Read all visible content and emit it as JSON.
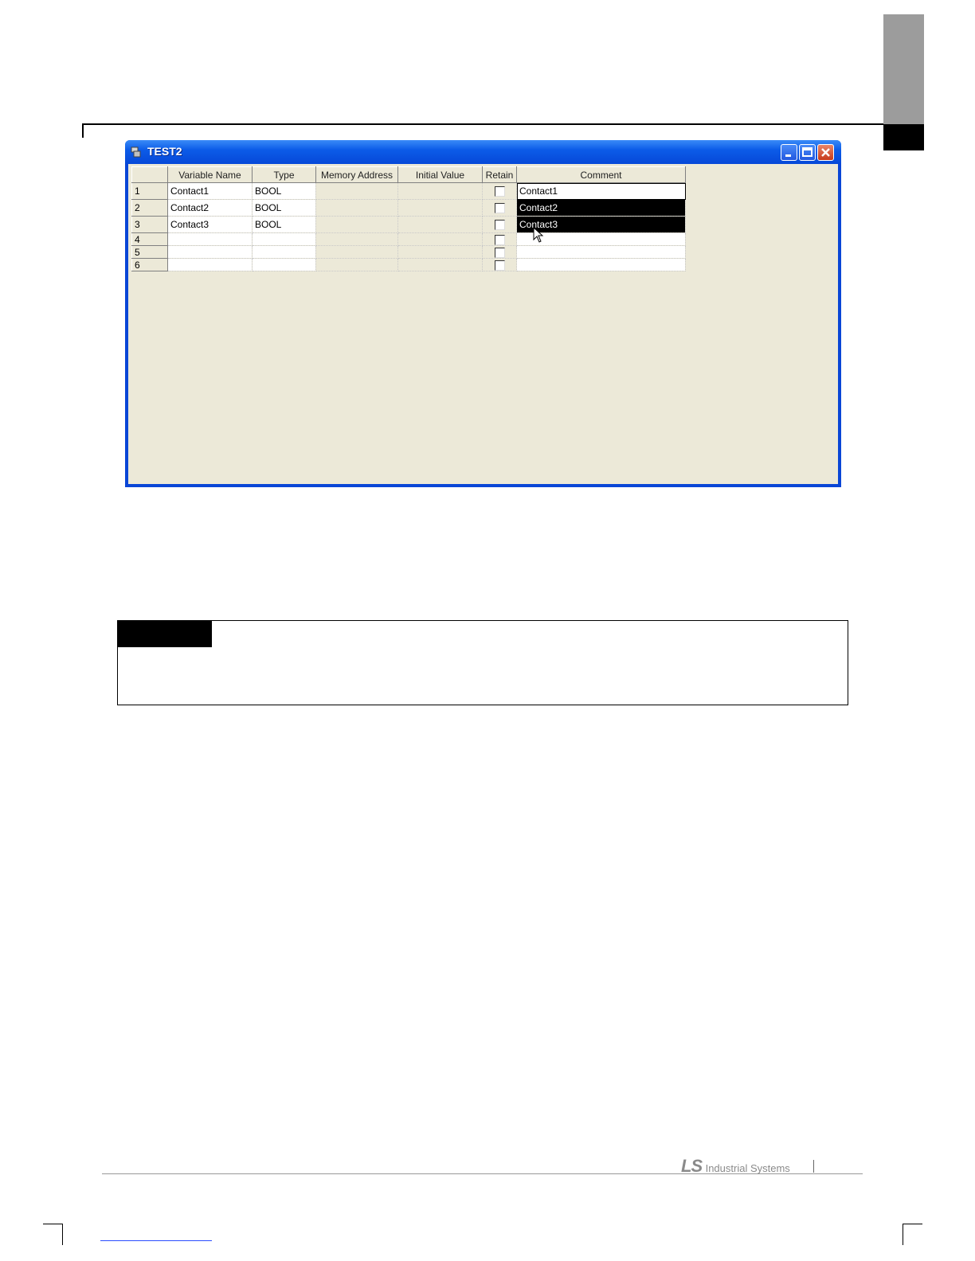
{
  "window": {
    "title": "TEST2"
  },
  "grid": {
    "columns": [
      "Variable Name",
      "Type",
      "Memory Address",
      "Initial Value",
      "Retain",
      "Comment"
    ],
    "rows": [
      {
        "num": "1",
        "name": "Contact1",
        "type": "BOOL",
        "address": "",
        "initial": "",
        "comment": "Contact1"
      },
      {
        "num": "2",
        "name": "Contact2",
        "type": "BOOL",
        "address": "",
        "initial": "",
        "comment": "Contact2"
      },
      {
        "num": "3",
        "name": "Contact3",
        "type": "BOOL",
        "address": "",
        "initial": "",
        "comment": "Contact3"
      },
      {
        "num": "4",
        "name": "",
        "type": "",
        "address": "",
        "initial": "",
        "comment": ""
      },
      {
        "num": "5",
        "name": "",
        "type": "",
        "address": "",
        "initial": "",
        "comment": ""
      },
      {
        "num": "6",
        "name": "",
        "type": "",
        "address": "",
        "initial": "",
        "comment": ""
      }
    ]
  },
  "footer": {
    "logo_mark": "LS",
    "logo_text": "Industrial Systems"
  }
}
